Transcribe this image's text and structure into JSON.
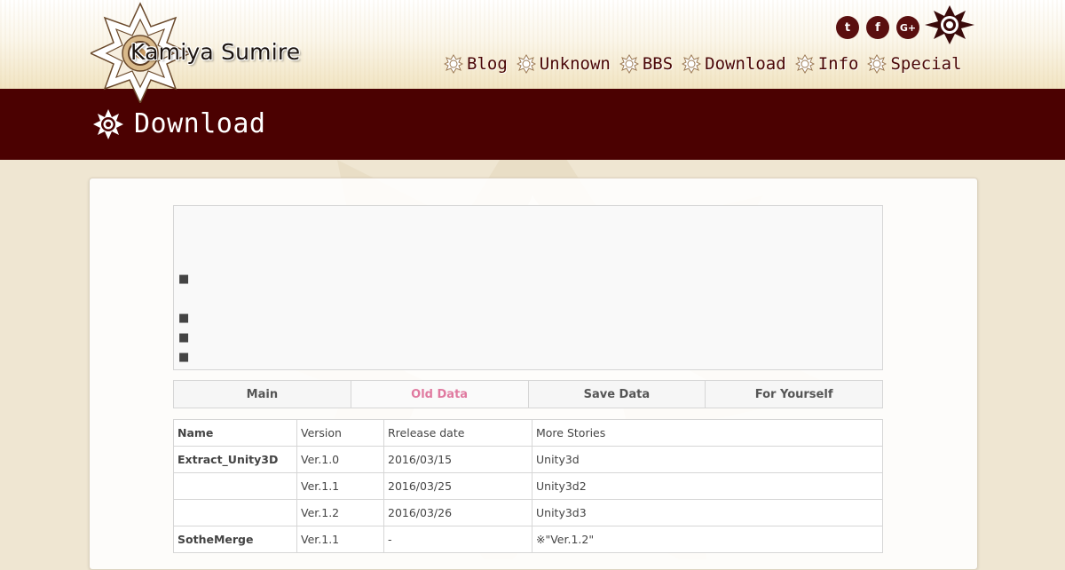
{
  "site": {
    "name": "Kamiya Sumire"
  },
  "social": [
    {
      "name": "twitter",
      "glyph": "t"
    },
    {
      "name": "facebook",
      "glyph": "f"
    },
    {
      "name": "google-plus",
      "glyph": "G+"
    }
  ],
  "nav": [
    "Blog",
    "Unknown",
    "BBS",
    "Download",
    "Info",
    "Special"
  ],
  "page": {
    "title": "Download"
  },
  "notice": {
    "bullets": [
      "■",
      "■",
      "■",
      "■"
    ]
  },
  "tabs": [
    "Main",
    "Old Data",
    "Save Data",
    "For Yourself"
  ],
  "tab_active_index": 1,
  "table": {
    "header": [
      "Name",
      "Version",
      "Rrelease date",
      "More Stories"
    ],
    "rows": [
      [
        "Extract_Unity3D",
        "Ver.1.0",
        "2016/03/15",
        "Unity3d"
      ],
      [
        "",
        "Ver.1.1",
        "2016/03/25",
        "Unity3d2"
      ],
      [
        "",
        "Ver.1.2",
        "2016/03/26",
        "Unity3d3"
      ],
      [
        "SotheMerge",
        "Ver.1.1",
        "-",
        "※\"Ver.1.2\""
      ]
    ]
  },
  "colors": {
    "accent": "#4b0101",
    "active_tab": "#e07aa0",
    "background": "#efe6d2"
  }
}
